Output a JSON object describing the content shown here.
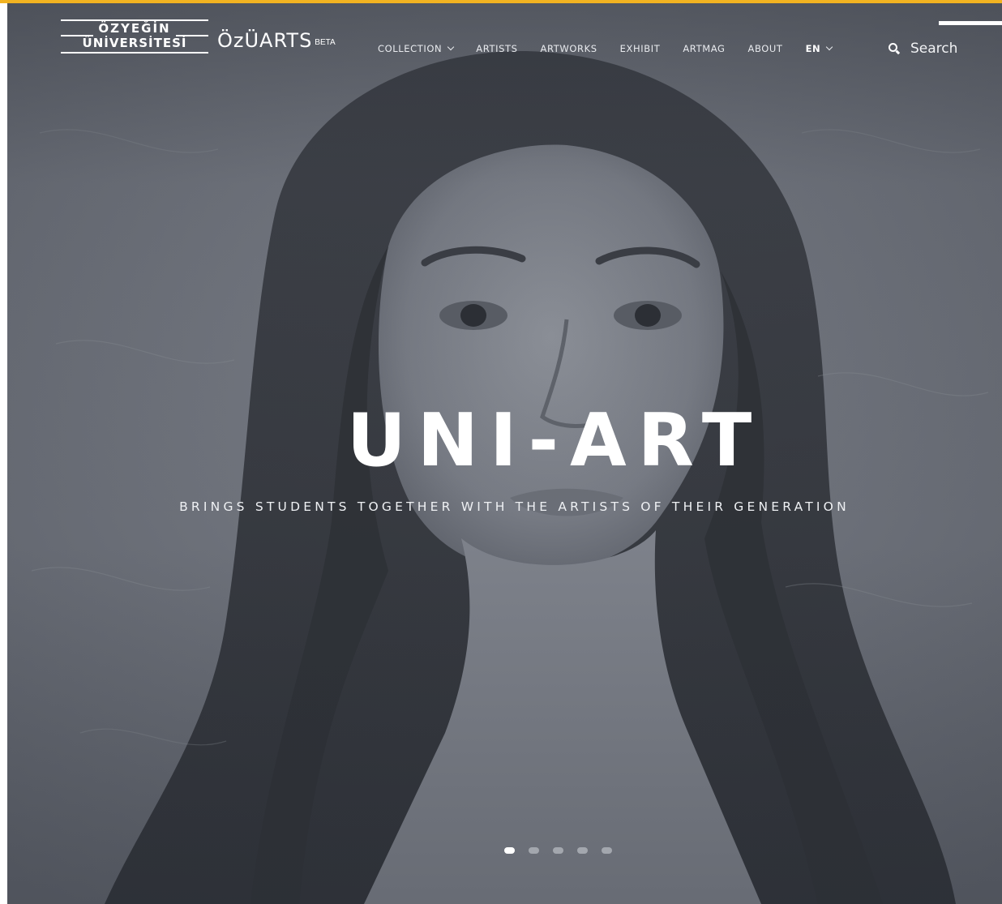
{
  "brand": {
    "university_line1": "ÖZYEĞİN",
    "university_line2": "ÜNİVERSİTESİ",
    "site_logo": "ÖzÜARTS",
    "badge": "BETA"
  },
  "nav": {
    "items": [
      {
        "label": "COLLECTION",
        "has_dropdown": true
      },
      {
        "label": "ARTISTS",
        "has_dropdown": false
      },
      {
        "label": "ARTWORKS",
        "has_dropdown": false
      },
      {
        "label": "EXHIBIT",
        "has_dropdown": false
      },
      {
        "label": "ARTMAG",
        "has_dropdown": false
      },
      {
        "label": "ABOUT",
        "has_dropdown": false
      }
    ],
    "language": {
      "label": "EN",
      "has_dropdown": true
    }
  },
  "search": {
    "icon": "search-icon",
    "placeholder": "Search",
    "value": ""
  },
  "hero": {
    "title": "UNI-ART",
    "subtitle": "BRINGS STUDENTS TOGETHER WITH THE ARTISTS OF THEIR GENERATION",
    "slides": {
      "count": 5,
      "active_index": 0
    }
  },
  "colors": {
    "accent": "#f2b321",
    "hero_tint": "#6b6f78",
    "text": "#ffffff"
  }
}
